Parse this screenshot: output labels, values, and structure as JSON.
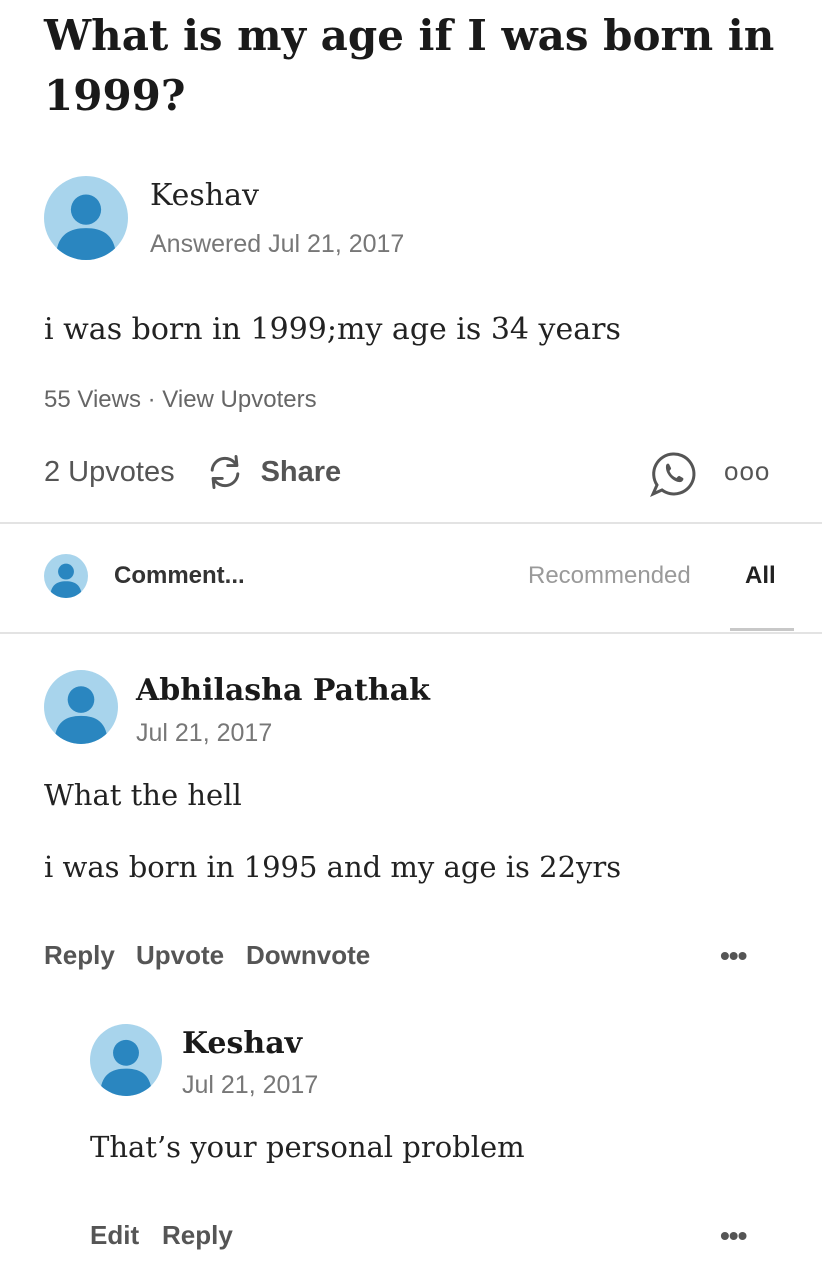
{
  "question": {
    "title": "What is my age if I was born in 1999?"
  },
  "answer": {
    "author": "Keshav",
    "answered": "Answered Jul 21, 2017",
    "text": "i was born in 1999;my age is 34 years",
    "views": "55 Views",
    "separator": "·",
    "view_upvoters": "View Upvoters",
    "upvotes": "2 Upvotes",
    "share_label": "Share",
    "more_label": "ooo"
  },
  "comment_bar": {
    "placeholder": "Comment...",
    "sort_recommended": "Recommended",
    "sort_all": "All"
  },
  "comments": [
    {
      "author": "Abhilasha Pathak",
      "date": "Jul 21, 2017",
      "lines": [
        "What the hell",
        "i was born in 1995 and my age is 22yrs"
      ],
      "actions": [
        "Reply",
        "Upvote",
        "Downvote"
      ],
      "more": "•••"
    },
    {
      "author": "Keshav",
      "date": "Jul 21, 2017",
      "lines": [
        "That’s your personal problem"
      ],
      "actions": [
        "Edit",
        "Reply"
      ],
      "more": "•••"
    }
  ],
  "icons": {
    "avatar": "user-avatar-icon",
    "share": "share-refresh-icon",
    "whatsapp": "whatsapp-icon",
    "more": "more-dots-icon"
  },
  "colors": {
    "avatar_bg": "#a8d4ec",
    "avatar_fg": "#2a86c0"
  }
}
